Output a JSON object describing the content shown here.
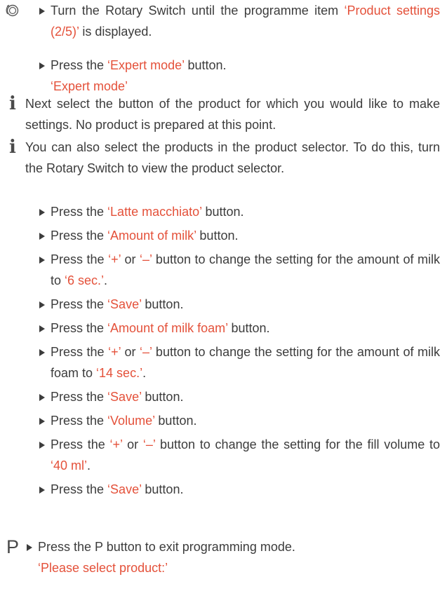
{
  "section_rotary": {
    "step1": {
      "pre": "Turn the Rotary Switch until the programme item ",
      "red": "‘Product settings (2/5)’",
      "post": " is displayed."
    },
    "step2": {
      "pre": "Press the ",
      "red": "‘Expert mode’",
      "post": " button."
    },
    "display": "‘Expert mode’"
  },
  "info1": "Next select the button of the product for which you would like to make settings. No product is prepared at this point.",
  "info2": "You can also select the products in the product selector. To do this, turn the Rotary Switch to view the product selector.",
  "steps": [
    {
      "pre": "Press the ",
      "red": "‘Latte macchiato’",
      "post": " button."
    },
    {
      "pre": "Press the ",
      "red": "‘Amount of milk’",
      "post": " button."
    },
    {
      "pre": "Press the ",
      "red": "‘+’",
      "mid": " or ",
      "red2": "‘–’",
      "mid2": " button to change the setting for the amount of milk to ",
      "red3": "‘6 sec.’",
      "post": "."
    },
    {
      "pre": "Press the ",
      "red": "‘Save’",
      "post": " button."
    },
    {
      "pre": "Press the ",
      "red": "‘Amount of milk foam’",
      "post": " button."
    },
    {
      "pre": "Press the ",
      "red": "‘+’",
      "mid": " or ",
      "red2": "‘–’",
      "mid2": " button to change the setting for the amount of milk foam to ",
      "red3": "‘14 sec.’",
      "post": "."
    },
    {
      "pre": "Press the ",
      "red": "‘Save’",
      "post": " button."
    },
    {
      "pre": "Press the ",
      "red": "‘Volume’",
      "post": " button."
    },
    {
      "pre": "Press the ",
      "red": "‘+’",
      "mid": " or ",
      "red2": "‘–’",
      "mid2": " button to change the setting for the fill volume to ",
      "red3": "‘40 ml’",
      "post": "."
    },
    {
      "pre": "Press the ",
      "red": "‘Save’",
      "post": " button."
    }
  ],
  "section_p": {
    "icon_label": "P",
    "step": "Press the P button to exit programming mode.",
    "display": "‘Please select product:’"
  },
  "info_icon_glyph": "i",
  "accent_color": "#e4513a",
  "text_color": "#3c3c3c",
  "icons": [
    "rotary-switch-icon",
    "info-icon",
    "p-button-icon"
  ]
}
